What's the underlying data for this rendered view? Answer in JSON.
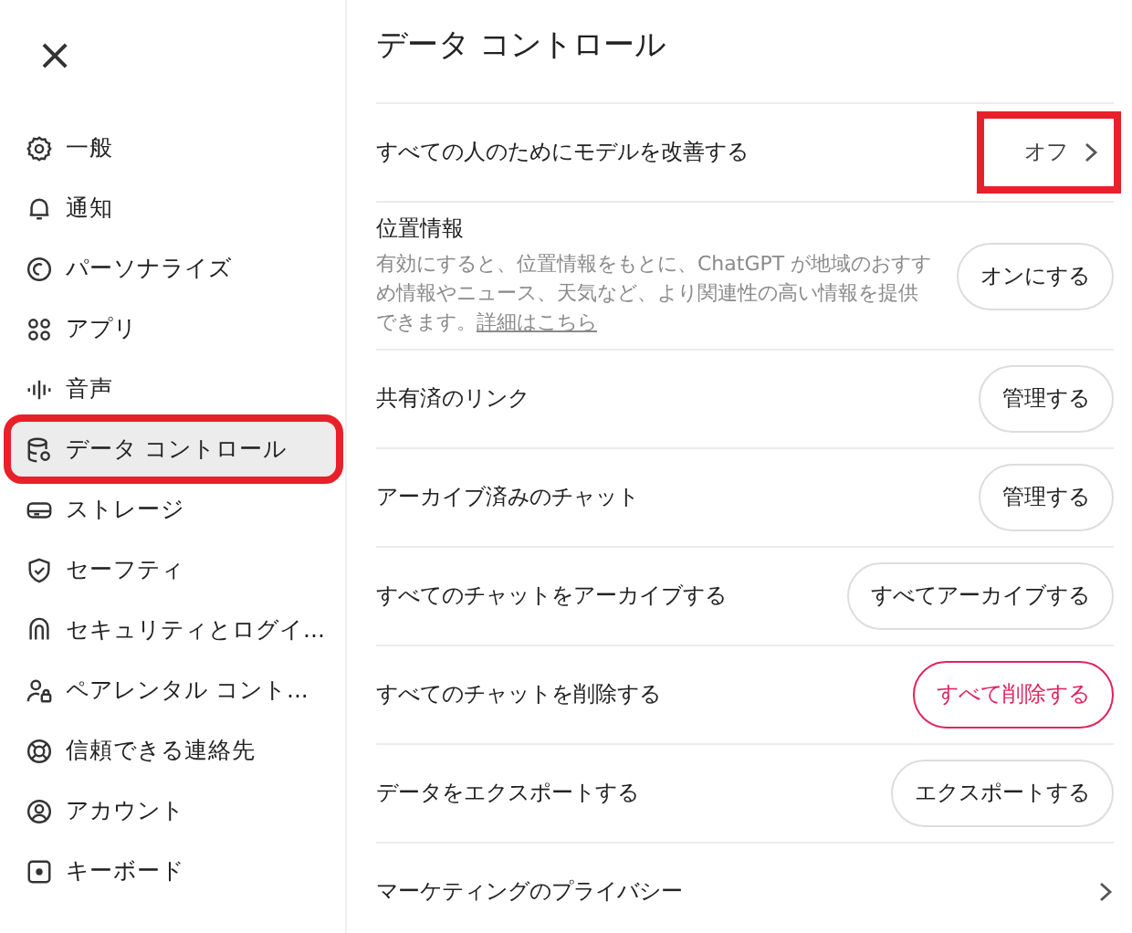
{
  "close_button": "×",
  "sidebar": {
    "items": [
      {
        "label": "一般",
        "selected": false,
        "annotated": false
      },
      {
        "label": "通知",
        "selected": false,
        "annotated": false
      },
      {
        "label": "パーソナライズ",
        "selected": false,
        "annotated": false
      },
      {
        "label": "アプリ",
        "selected": false,
        "annotated": false
      },
      {
        "label": "音声",
        "selected": false,
        "annotated": false
      },
      {
        "label": "データ コントロール",
        "selected": true,
        "annotated": true
      },
      {
        "label": "ストレージ",
        "selected": false,
        "annotated": false
      },
      {
        "label": "セーフティ",
        "selected": false,
        "annotated": false
      },
      {
        "label": "セキュリティとログイ...",
        "selected": false,
        "annotated": false
      },
      {
        "label": "ペアレンタル コント...",
        "selected": false,
        "annotated": false
      },
      {
        "label": "信頼できる連絡先",
        "selected": false,
        "annotated": false
      },
      {
        "label": "アカウント",
        "selected": false,
        "annotated": false
      },
      {
        "label": "キーボード",
        "selected": false,
        "annotated": false
      }
    ]
  },
  "panel": {
    "title": "データ コントロール",
    "rows": [
      {
        "kind": "value",
        "label": "すべての人のためにモデルを改善する",
        "value": "オフ",
        "annotated": true
      },
      {
        "kind": "button",
        "label": "位置情報",
        "description": "有効にすると、位置情報をもとに、ChatGPT が地域のおすすめ情報やニュース、天気など、より関連性の高い情報を提供できます。",
        "link": "詳細はこちら",
        "button": "オンにする"
      },
      {
        "kind": "button",
        "label": "共有済のリンク",
        "button": "管理する"
      },
      {
        "kind": "button",
        "label": "アーカイブ済みのチャット",
        "button": "管理する"
      },
      {
        "kind": "button",
        "label": "すべてのチャットをアーカイブする",
        "button": "すべてアーカイブする"
      },
      {
        "kind": "danger",
        "label": "すべてのチャットを削除する",
        "button": "すべて削除する"
      },
      {
        "kind": "button",
        "label": "データをエクスポートする",
        "button": "エクスポートする"
      },
      {
        "kind": "chevron",
        "label": "マーケティングのプライバシー"
      }
    ]
  }
}
